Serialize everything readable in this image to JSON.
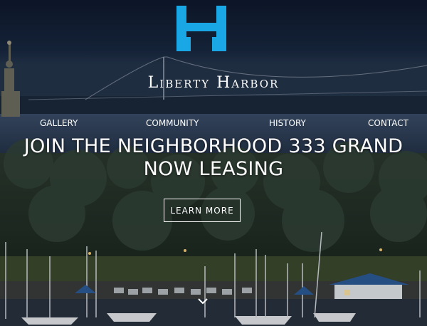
{
  "site": {
    "brand_name": "Liberty Harbor",
    "logo_icon": "liberty-harbor-logo-icon"
  },
  "nav": {
    "items": [
      {
        "label": "GALLERY"
      },
      {
        "label": "COMMUNITY"
      },
      {
        "label": "HISTORY"
      },
      {
        "label": "CONTACT"
      }
    ]
  },
  "hero": {
    "headline_line1": "JOIN THE NEIGHBORHOOD 333 GRAND",
    "headline_line2": "NOW LEASING",
    "cta_label": "LEARN MORE",
    "scroll_icon": "chevron-down-icon"
  },
  "colors": {
    "accent": "#1aa7e6",
    "text": "#ffffff",
    "sky": "#13213a"
  }
}
